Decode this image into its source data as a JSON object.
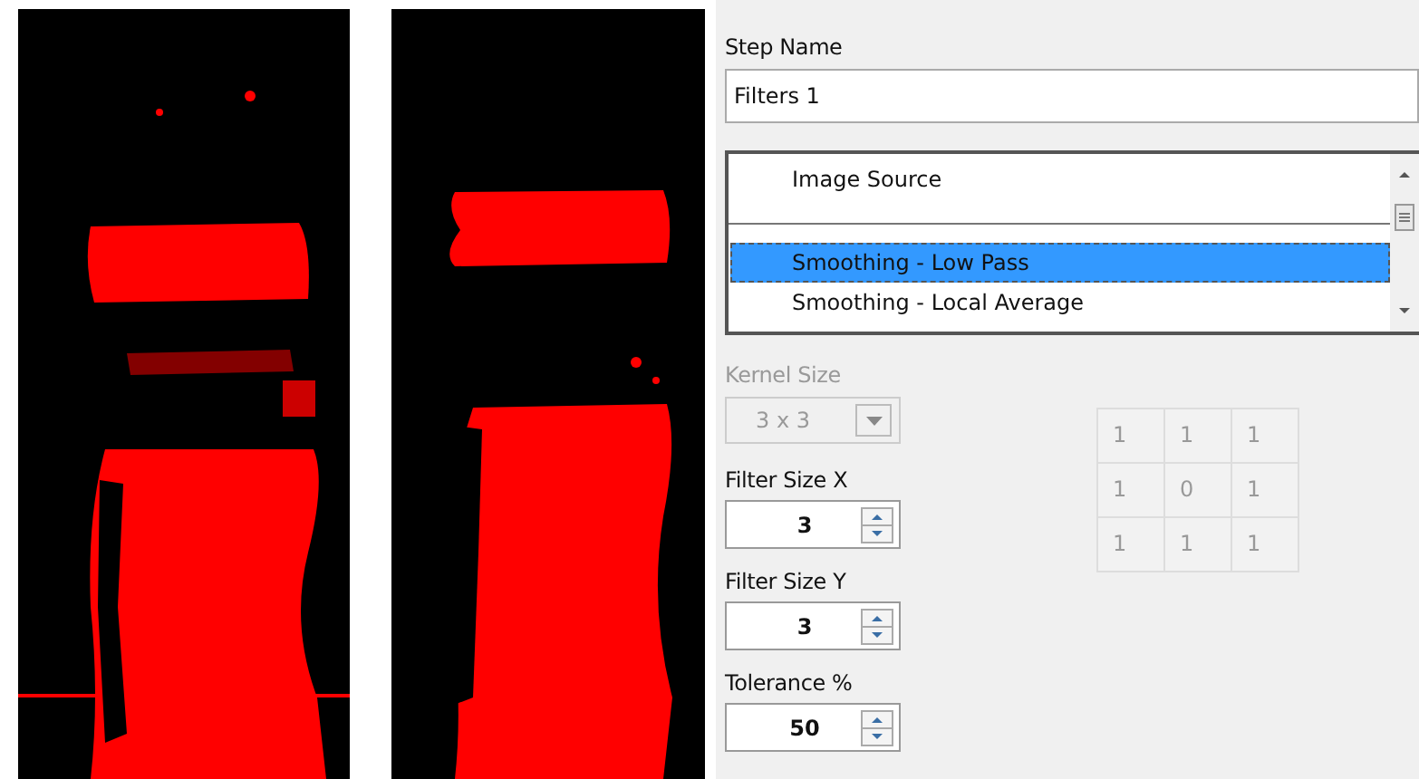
{
  "step_name": {
    "label": "Step Name",
    "value": "Filters 1"
  },
  "filter_list": {
    "groups": [
      {
        "items": [
          {
            "label": "Image Source",
            "selected": false
          }
        ]
      },
      {
        "items": [
          {
            "label": "Smoothing - Low Pass",
            "selected": true
          },
          {
            "label": "Smoothing - Local Average",
            "selected": false
          }
        ]
      }
    ]
  },
  "kernel_size": {
    "label": "Kernel Size",
    "value": "3 x 3",
    "disabled": true
  },
  "fields": [
    {
      "label": "Filter Size X",
      "value": "3"
    },
    {
      "label": "Filter Size Y",
      "value": "3"
    },
    {
      "label": "Tolerance %",
      "value": "50"
    }
  ],
  "kernel_matrix": {
    "disabled": true,
    "rows": [
      [
        "1",
        "1",
        "1"
      ],
      [
        "1",
        "0",
        "1"
      ],
      [
        "1",
        "1",
        "1"
      ]
    ]
  }
}
